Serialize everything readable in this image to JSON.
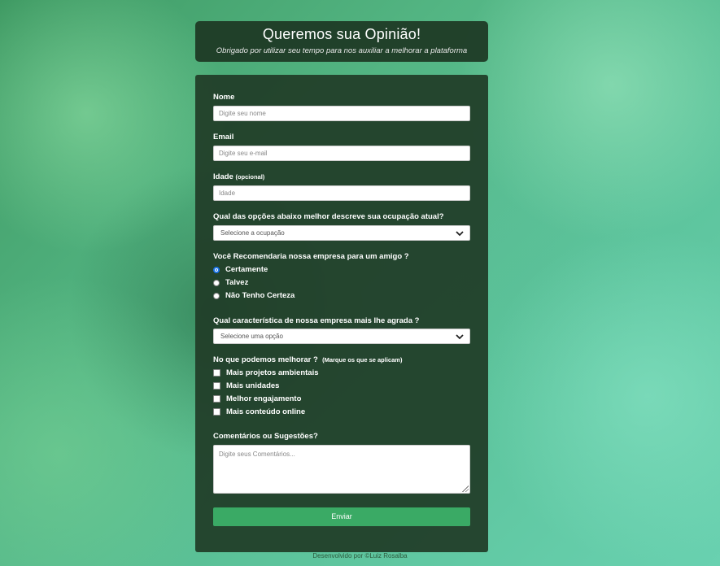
{
  "header": {
    "title": "Queremos sua Opinião!",
    "subtitle": "Obrigado por utilizar seu tempo para nos auxiliar a melhorar a plataforma"
  },
  "form": {
    "name": {
      "label": "Nome",
      "placeholder": "Digite seu nome"
    },
    "email": {
      "label": "Email",
      "placeholder": "Digite seu e-mail"
    },
    "age": {
      "label": "Idade",
      "hint": "(opcional)",
      "placeholder": "Idade"
    },
    "occupation": {
      "label": "Qual das opções abaixo melhor descreve sua ocupação atual?",
      "selected": "Selecione a ocupação"
    },
    "recommend": {
      "label": "Você Recomendaria nossa empresa para um amigo ?",
      "options": [
        "Certamente",
        "Talvez",
        "Não Tenho Certeza"
      ],
      "selected": "Certamente"
    },
    "feature": {
      "label": "Qual característica de nossa empresa mais lhe agrada ?",
      "selected": "Selecione uma opção"
    },
    "improve": {
      "label": "No que podemos melhorar ?",
      "hint": "(Marque os que se aplicam)",
      "options": [
        "Mais projetos ambientais",
        "Mais unidades",
        "Melhor engajamento",
        "Mais conteúdo online"
      ]
    },
    "comments": {
      "label": "Comentários ou Sugestões?",
      "placeholder": "Digite seus Comentários..."
    },
    "submit_label": "Enviar"
  },
  "footer": {
    "text": "Desenvolvido por ©Luiz Rosalba"
  },
  "colors": {
    "panel": "#213e28",
    "button": "#3aaa65",
    "radio_selected": "#1a73e8"
  }
}
